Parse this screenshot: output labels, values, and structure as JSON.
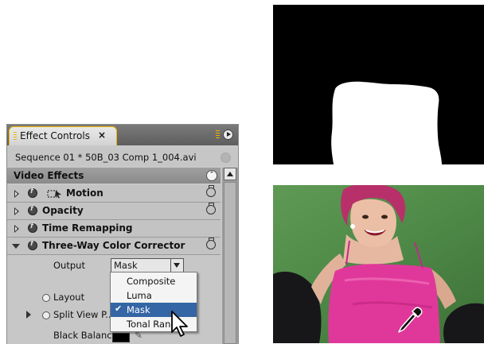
{
  "panel": {
    "tab_title": "Effect Controls",
    "tab_close": "×",
    "sequence": "Sequence 01 * 50B_03 Comp 1_004.avi",
    "section_title": "Video Effects",
    "effects": [
      {
        "label": "Motion",
        "expanded": false,
        "icon": "motion-icon"
      },
      {
        "label": "Opacity",
        "expanded": false
      },
      {
        "label": "Time Remapping",
        "expanded": false
      },
      {
        "label": "Three-Way Color Corrector",
        "expanded": true
      }
    ],
    "properties": {
      "output_label": "Output",
      "output_value": "Mask",
      "layout_label": "Layout",
      "split_view_label": "Split View P...",
      "black_balance_label": "Black Balance",
      "black_balance_color": "#000000"
    },
    "output_options": [
      {
        "label": "Composite",
        "selected": false
      },
      {
        "label": "Luma",
        "selected": false
      },
      {
        "label": "Mask",
        "selected": true
      },
      {
        "label": "Tonal Rang",
        "selected": false
      }
    ]
  },
  "previews": {
    "top": "mask-preview",
    "bottom": "green-screen-photo"
  },
  "colors": {
    "panel_bg": "#c8c8c8",
    "tab_accent": "#f0b400",
    "menu_highlight": "#3465a4",
    "green_screen": "#5f9a55",
    "dress_pink": "#e0389a"
  }
}
